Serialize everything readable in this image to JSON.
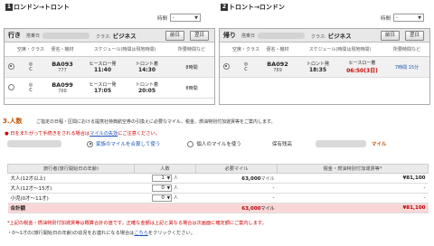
{
  "outbound": {
    "route_num": "1",
    "route_label": "ロンドン→トロント",
    "time_label": "時間",
    "time_value": "-",
    "dir_label": "行き",
    "date_label": "搭乗日",
    "class_label": "クラス:",
    "class_value": "ビジネス",
    "prev_day": "前日",
    "next_day": "翌日",
    "columns": [
      "空席・クラス",
      "便名・機材",
      "スケジュール(時間は現地時間)",
      "所要時間など"
    ],
    "flights": [
      {
        "seat": "◎",
        "cls": "C",
        "flight": "BA093",
        "equip": "777",
        "from": "ヒースロー発",
        "dep": "11:40",
        "to": "トロント着",
        "arr": "14:30",
        "dur": "8時間",
        "selected": true
      },
      {
        "seat": "◎",
        "cls": "C",
        "flight": "BA099",
        "equip": "788",
        "from": "ヒースロー発",
        "dep": "17:05",
        "to": "トロント着",
        "arr": "20:05",
        "dur": "8時間",
        "selected": false
      }
    ]
  },
  "inbound": {
    "route_num": "2",
    "route_label": "トロント→ロンドン",
    "time_label": "時間",
    "time_value": "-",
    "dir_label": "帰り",
    "date_label": "搭乗日",
    "class_label": "クラス:",
    "class_value": "ビジネス",
    "prev_day": "前日",
    "next_day": "翌日",
    "columns": [
      "空席・クラス",
      "便名・機材",
      "スケジュール(時間は現地時間)",
      "所要時間など"
    ],
    "flights": [
      {
        "seat": "◎",
        "cls": "C",
        "flight": "BA092",
        "equip": "789",
        "from": "トロント発",
        "dep": "18:35",
        "to": "ヒースロー着",
        "arr": "06:50(3日)",
        "dur": "7時間 15分",
        "selected": true
      }
    ]
  },
  "section3": {
    "title": "3.人数",
    "description": "ご指定の日程・区間における提携社特典航空券の引換えに必要なマイル、税金、燃油特別付加運賃等をご案内します。",
    "warning_prefix": "日をまたがって手続きをされる場合は",
    "warning_link": "マイルの失効",
    "warning_suffix": "にご注意ください。",
    "option1": "家族のマイルを合算して使う",
    "option2": "個人のマイルを使う",
    "balance_label": "保有残高",
    "balance_unit": "マイル"
  },
  "pax_table": {
    "headers": [
      "旅行者(旅行開始日の年齢)",
      "人数",
      "必要マイル",
      "税金・燃油特別付加運賃等*"
    ],
    "rows": [
      {
        "label": "大人(12才以上)",
        "qty": "1",
        "unit": "人",
        "miles": "63,000",
        "miles_unit": "マイル",
        "tax": "¥81,100"
      },
      {
        "label": "大人(12才〜15才)",
        "qty": "0",
        "unit": "人",
        "miles": "-",
        "miles_unit": "",
        "tax": "-"
      },
      {
        "label": "小児(0才〜11才)",
        "qty": "0",
        "unit": "人",
        "miles": "-",
        "miles_unit": "",
        "tax": "-"
      }
    ],
    "total_label": "合計額",
    "total_miles": "63,000",
    "total_miles_unit": "マイル",
    "total_tax": "¥81,100"
  },
  "notes": {
    "note1": "*上記の税金・燃油特別付加運賃等は概算合計の値です。正確な金額は上記と異なる場合は次画面に確定額にご案内します。",
    "note2_prefix": "・0〜1才の(旅行開始日の年齢)の幼児をお連れになる場合は",
    "note2_link": "こちら",
    "note2_suffix": "をクリックください。"
  }
}
